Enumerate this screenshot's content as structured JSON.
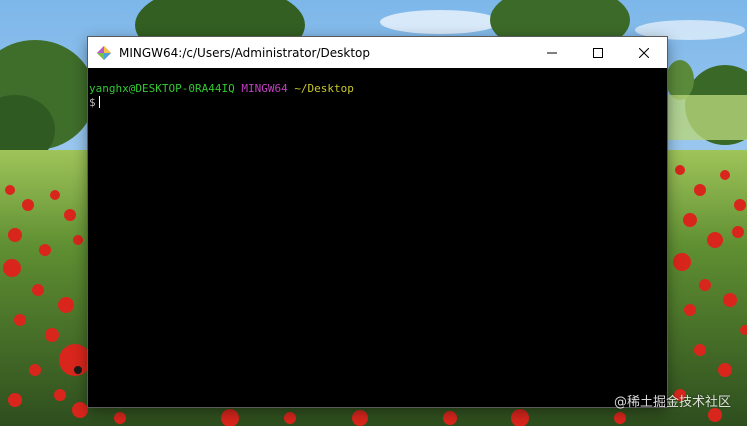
{
  "window": {
    "title": "MINGW64:/c/Users/Administrator/Desktop"
  },
  "terminal": {
    "user_host": "yanghx@DESKTOP-0RA44IQ",
    "msystem": "MINGW64",
    "cwd": "~/Desktop",
    "prompt": "$"
  },
  "watermark": {
    "text": "@稀土掘金技术社区"
  },
  "colors": {
    "user": "#32c832",
    "msystem": "#c23fc2",
    "cwd": "#c8c832",
    "background": "#000000"
  },
  "icons": {
    "app": "git-diamond-icon",
    "minimize": "minimize-icon",
    "maximize": "maximize-icon",
    "close": "close-icon"
  }
}
